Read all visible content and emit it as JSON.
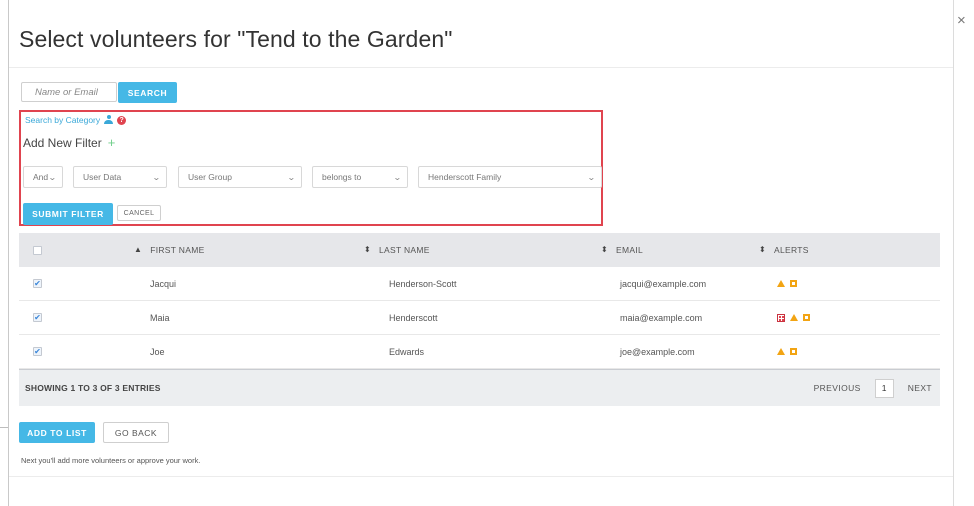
{
  "modal": {
    "title": "Select volunteers for \"Tend to the Garden\"",
    "close_label": "×"
  },
  "search": {
    "placeholder": "Name or Email",
    "button_label": "SEARCH"
  },
  "filter": {
    "category_link": "Search by Category",
    "help_label": "?",
    "add_new_label": "Add New Filter",
    "plus_label": "+",
    "selects": [
      {
        "value": "And"
      },
      {
        "value": "User Data"
      },
      {
        "value": "User Group"
      },
      {
        "value": "belongs to"
      },
      {
        "value": "Henderscott Family"
      }
    ],
    "submit_label": "SUBMIT FILTER",
    "cancel_label": "CANCEL"
  },
  "table": {
    "sort_icon": "▲",
    "sort_both_icon": "⬍",
    "check_mark": "✔",
    "columns": [
      "FIRST NAME",
      "LAST NAME",
      "EMAIL",
      "ALERTS"
    ],
    "rows": [
      {
        "checked": true,
        "first": "Jacqui",
        "last": "Henderson-Scott",
        "email": "jacqui@example.com",
        "alerts": [
          "warning-triangle",
          "flag-square"
        ]
      },
      {
        "checked": true,
        "first": "Maia",
        "last": "Henderscott",
        "email": "maia@example.com",
        "alerts": [
          "calendar",
          "warning-triangle",
          "flag-square"
        ]
      },
      {
        "checked": true,
        "first": "Joe",
        "last": "Edwards",
        "email": "joe@example.com",
        "alerts": [
          "warning-triangle",
          "flag-square"
        ]
      }
    ],
    "footer": {
      "showing": "SHOWING 1 TO 3 OF 3 ENTRIES",
      "previous": "PREVIOUS",
      "page": "1",
      "next": "NEXT"
    }
  },
  "actions": {
    "add_to_list": "ADD TO LIST",
    "go_back": "GO BACK",
    "note": "Next you'll add more volunteers or approve your work."
  },
  "colors": {
    "accent": "#45b8e6",
    "highlight_border": "#e0444f",
    "alert_orange": "#f2a413",
    "table_header_bg": "#e6e7ea"
  }
}
